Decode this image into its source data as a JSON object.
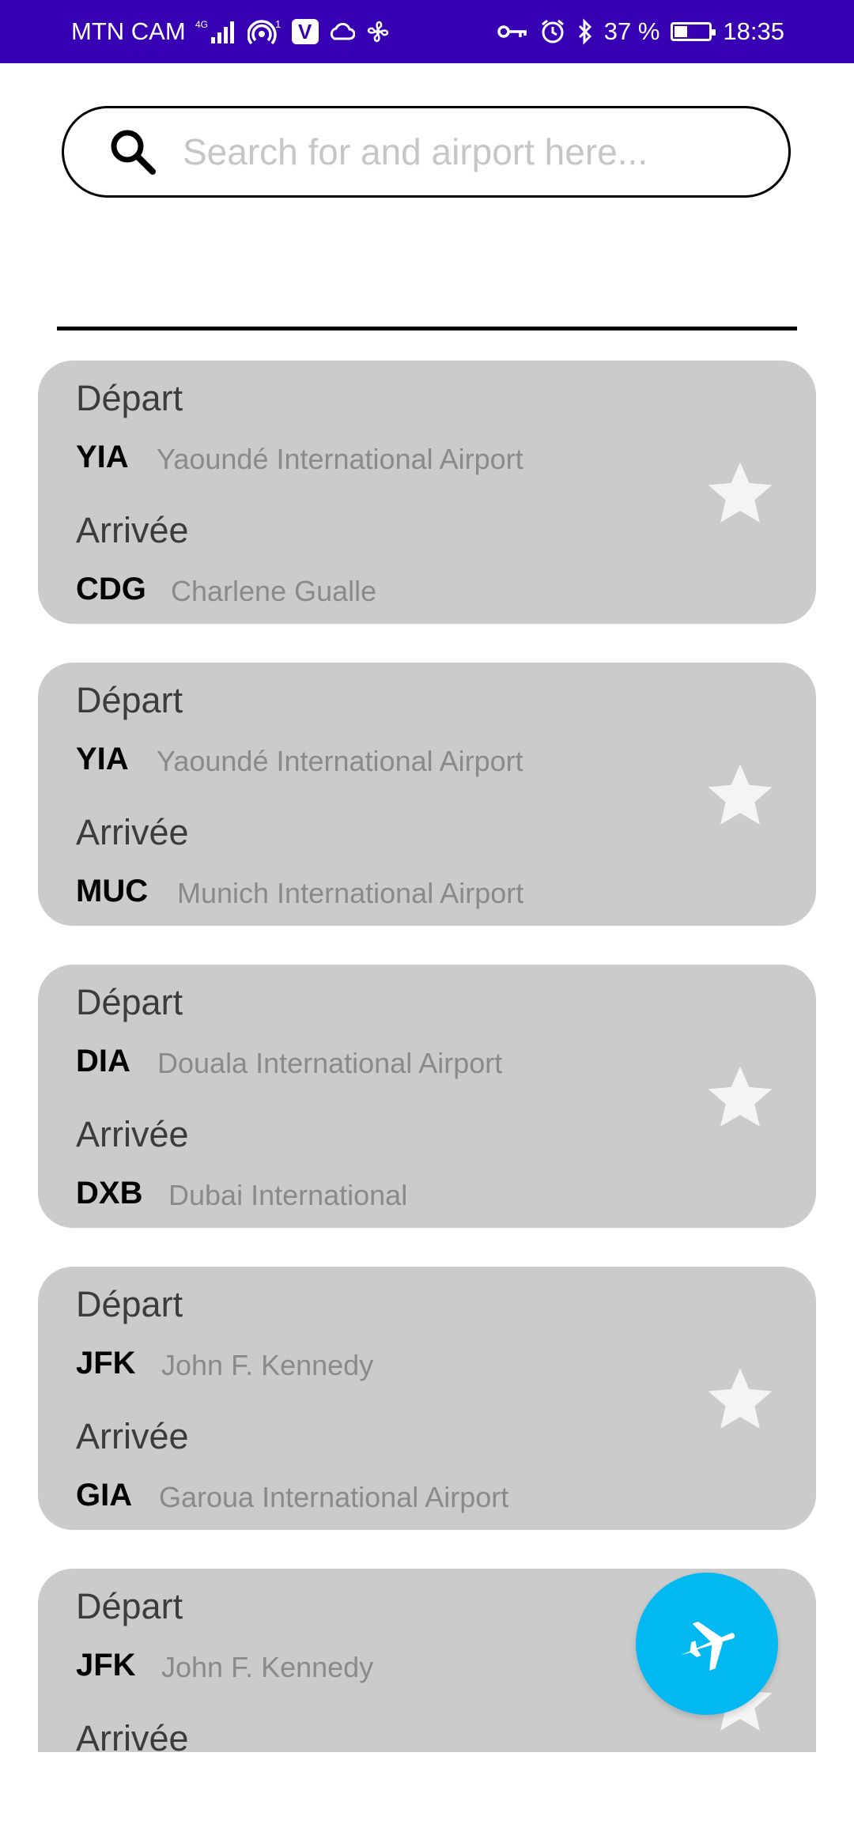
{
  "status_bar": {
    "carrier": "MTN CAM",
    "network_type": "4G",
    "sim_slot": "1",
    "viber_letter": "V",
    "battery_percent": "37 %",
    "battery_level": 0.37,
    "time": "18:35",
    "icons": [
      "signal-icon",
      "hotspot-icon",
      "viber-icon",
      "cloud-icon",
      "fan-icon",
      "key-icon",
      "alarm-icon",
      "bluetooth-icon",
      "battery-icon"
    ]
  },
  "search": {
    "placeholder": "Search for and airport here...",
    "value": "",
    "icon": "search-icon"
  },
  "flights": [
    {
      "departure_label": "Départ",
      "departure_code": "YIA",
      "departure_name": "Yaoundé International Airport",
      "arrival_label": "Arrivée",
      "arrival_code": "CDG",
      "arrival_name": "Charlene Gualle",
      "favorite_icon": "star-icon"
    },
    {
      "departure_label": "Départ",
      "departure_code": "YIA",
      "departure_name": "Yaoundé International Airport",
      "arrival_label": "Arrivée",
      "arrival_code": "MUC",
      "arrival_name": "Munich International Airport",
      "favorite_icon": "star-icon"
    },
    {
      "departure_label": "Départ",
      "departure_code": "DIA",
      "departure_name": "Douala International Airport",
      "arrival_label": "Arrivée",
      "arrival_code": "DXB",
      "arrival_name": "Dubai International",
      "favorite_icon": "star-icon"
    },
    {
      "departure_label": "Départ",
      "departure_code": "JFK",
      "departure_name": "John F. Kennedy",
      "arrival_label": "Arrivée",
      "arrival_code": "GIA",
      "arrival_name": "Garoua International Airport",
      "favorite_icon": "star-icon"
    },
    {
      "departure_label": "Départ",
      "departure_code": "JFK",
      "departure_name": "John F. Kennedy",
      "arrival_label": "Arrivée",
      "arrival_code": "",
      "arrival_name": "",
      "favorite_icon": "star-icon"
    }
  ],
  "fab": {
    "icon": "airplane-icon"
  },
  "colors": {
    "status_bar": "#3700b3",
    "card_background": "#cbcbcb",
    "fab": "#03b9f1",
    "star": "#f4f4f4",
    "placeholder": "#c6c6c6"
  }
}
